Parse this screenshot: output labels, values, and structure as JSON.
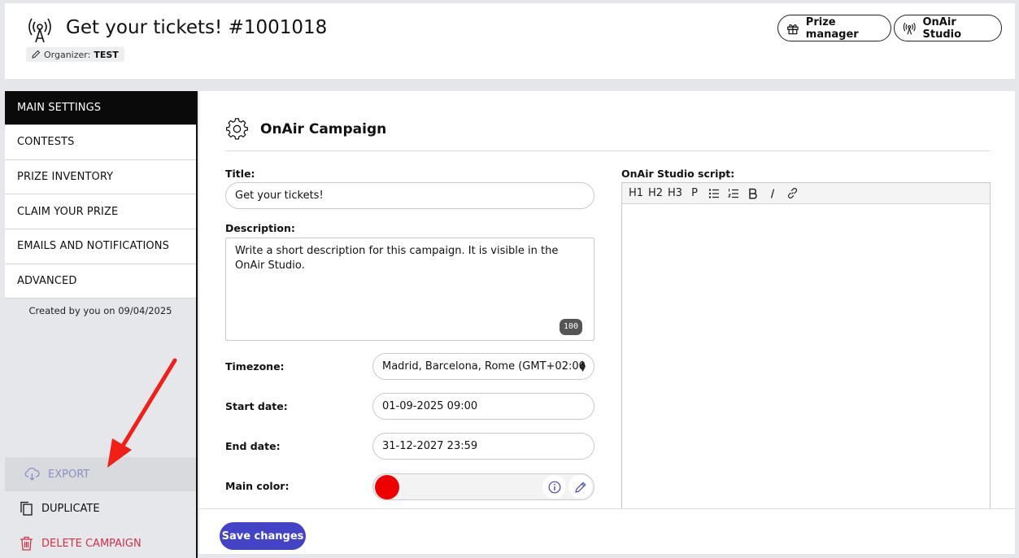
{
  "header": {
    "title": "Get your tickets! #1001018",
    "organizer_label": "Organizer:",
    "organizer_value": "TEST",
    "prize_manager_label": "Prize manager",
    "onair_studio_label": "OnAir Studio"
  },
  "sidebar": {
    "items": [
      {
        "label": "MAIN SETTINGS"
      },
      {
        "label": "CONTESTS"
      },
      {
        "label": "PRIZE INVENTORY"
      },
      {
        "label": "CLAIM YOUR PRIZE"
      },
      {
        "label": "EMAILS AND NOTIFICATIONS"
      },
      {
        "label": "ADVANCED"
      }
    ],
    "created_text": "Created by you on 09/04/2025",
    "export_label": "EXPORT",
    "duplicate_label": "DUPLICATE",
    "delete_label": "DELETE CAMPAIGN"
  },
  "main": {
    "section_title": "OnAir Campaign",
    "title_label": "Title:",
    "title_value": "Get your tickets!",
    "description_label": "Description:",
    "description_value": "Write a short description for this campaign. It is visible in the OnAir Studio.",
    "description_counter": "100",
    "timezone_label": "Timezone:",
    "timezone_value": "Madrid, Barcelona, Rome (GMT+02:00",
    "start_label": "Start date:",
    "start_value": "01-09-2025 09:00",
    "end_label": "End date:",
    "end_value": "31-12-2027 23:59",
    "color_label": "Main color:",
    "main_color": "#ee0000",
    "script_label": "OnAir Studio script:",
    "toolbar": [
      "H1",
      "H2",
      "H3",
      "P"
    ]
  },
  "footer": {
    "save_label": "Save changes"
  },
  "colors": {
    "accent": "#4343c8",
    "danger": "#d0314a",
    "export": "#8b8ec9"
  }
}
